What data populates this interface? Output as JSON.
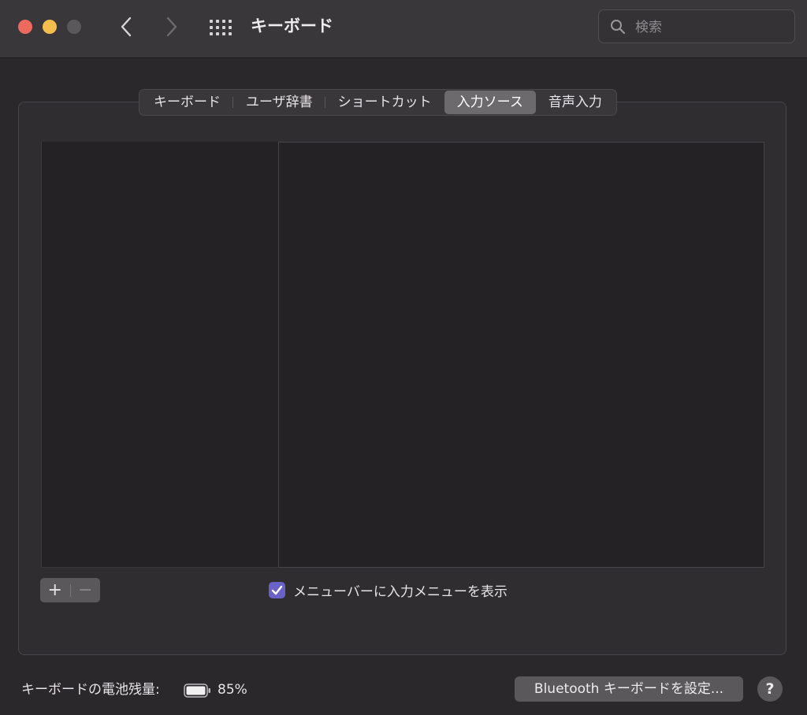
{
  "window": {
    "title": "キーボード",
    "search": {
      "placeholder": "検索",
      "value": ""
    }
  },
  "tabs": [
    {
      "label": "キーボード",
      "active": false
    },
    {
      "label": "ユーザ辞書",
      "active": false
    },
    {
      "label": "ショートカット",
      "active": false
    },
    {
      "label": "入力ソース",
      "active": true
    },
    {
      "label": "音声入力",
      "active": false
    }
  ],
  "controls": {
    "add_label": "+",
    "remove_label": "−",
    "show_input_menu_label": "メニューバーに入力メニューを表示",
    "show_input_menu_checked": true
  },
  "footer": {
    "battery_label": "キーボードの電池残量:",
    "battery_percent": "85%",
    "bluetooth_button_label": "Bluetooth キーボードを設定...",
    "help_label": "?"
  },
  "colors": {
    "accent": "#6a62c8",
    "close": "#ed6a5e",
    "minimize": "#f4be4f",
    "zoom_disabled": "#5b585c"
  },
  "icons": {
    "back": "chevron-left-icon",
    "forward": "chevron-right-icon",
    "grid": "grid-icon",
    "search": "search-icon",
    "battery": "battery-icon",
    "checkmark": "checkmark-icon"
  }
}
